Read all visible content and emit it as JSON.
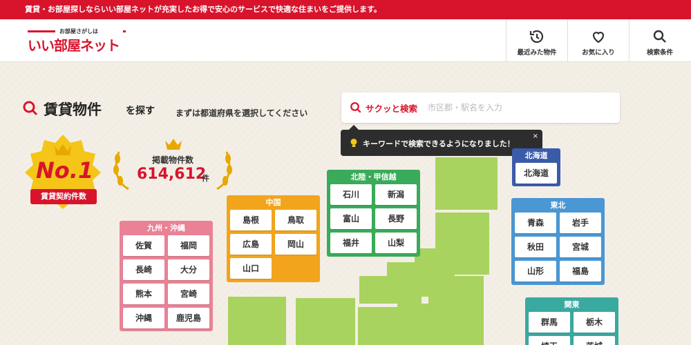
{
  "top_strip": "賃貸・お部屋探しならいい部屋ネットが充実したお得で安心のサービスで快適な住まいをご提供します。",
  "logo": {
    "small": "お部屋さがしは",
    "main": "いい部屋ネット"
  },
  "nav": [
    {
      "label": "最近みた物件",
      "icon": "history-icon"
    },
    {
      "label": "お気に入り",
      "icon": "heart-icon"
    },
    {
      "label": "検索条件",
      "icon": "search-icon"
    }
  ],
  "heading": {
    "main": "賃貸物件",
    "small": "を探す",
    "sub": "まずは都道府県を選択してください"
  },
  "search": {
    "label": "サクッと検索",
    "placeholder": "市区郡・駅名を入力"
  },
  "tooltip": {
    "text": "キーワードで検索できるようになりました！",
    "close": "×"
  },
  "badge": {
    "rank": "No.1",
    "label": "賃貸契約件数"
  },
  "listing": {
    "label": "掲載物件数",
    "count": "614,612",
    "unit": "件"
  },
  "regions": {
    "hokkaido": {
      "title": "北海道",
      "prefs": [
        "北海道"
      ],
      "color": "#3a5ba9"
    },
    "tohoku": {
      "title": "東北",
      "prefs": [
        "青森",
        "岩手",
        "秋田",
        "宮城",
        "山形",
        "福島"
      ],
      "color": "#4a97d4"
    },
    "kanto": {
      "title": "関東",
      "prefs": [
        "群馬",
        "栃木",
        "埼玉",
        "茨城"
      ],
      "color": "#3aa9a0"
    },
    "hokuriku": {
      "title": "北陸・甲信越",
      "prefs": [
        "石川",
        "新潟",
        "富山",
        "長野",
        "福井",
        "山梨"
      ],
      "color": "#3aab5a"
    },
    "chugoku": {
      "title": "中国",
      "prefs": [
        "島根",
        "鳥取",
        "広島",
        "岡山",
        "山口"
      ],
      "color": "#f2a51c"
    },
    "kyushu": {
      "title": "九州・沖縄",
      "prefs": [
        "佐賀",
        "福岡",
        "長崎",
        "大分",
        "熊本",
        "宮崎",
        "沖縄",
        "鹿児島"
      ],
      "color": "#ea8296"
    }
  }
}
